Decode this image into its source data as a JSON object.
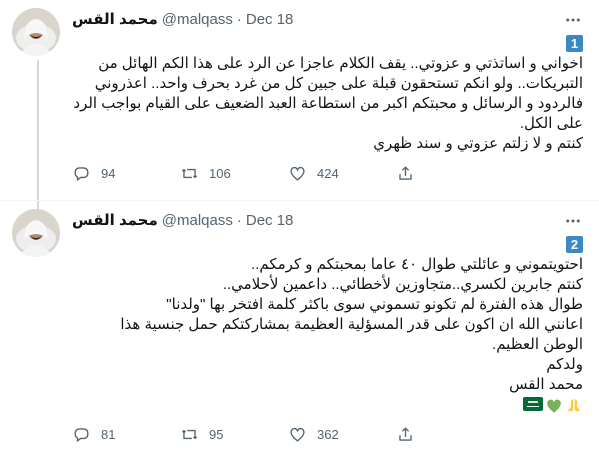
{
  "tweets": [
    {
      "name": "محمد القس",
      "handle": "@malqass",
      "dot": "·",
      "date": "Dec 18",
      "badge": "1",
      "lines": [
        "اخواني و اساتذتي و عزوتي.. يقف الكلام عاجزا عن الرد على هذا الكم الهائل من",
        "التبريكات.. ولو انكم تستحقون قبلة على جبين كل  من غرد بحرف واحد.. اعذروني",
        "فالردود و الرسائل و محبتكم اكبر من استطاعة العبد الضعيف على القيام بواجب الرد",
        "على الكل.",
        "كنتم و لا زلتم عزوتي و سند ظهري"
      ],
      "replies": "94",
      "retweets": "106",
      "likes": "424"
    },
    {
      "name": "محمد القس",
      "handle": "@malqass",
      "dot": "·",
      "date": "Dec 18",
      "badge": "2",
      "lines": [
        "احتويتموني و عائلتي طوال ٤٠ عاما بمحبتكم و كرمكم..",
        "كنتم جابرين لكسري..متجاوزين لأخطائي.. داعمين لأحلامي..",
        "طوال هذه الفترة لم تكونو تسموني سوى باكثر كلمة افتخر بها \"ولدنا\"",
        "اعانني الله ان اكون على قدر المسؤلية العظيمة بمشاركتكم حمل جنسية هذا",
        "الوطن العظيم.",
        "ولدكم",
        "محمد القس"
      ],
      "emojis": [
        "flag-icon",
        "green-heart-icon",
        "folded-hands-icon"
      ],
      "replies": "81",
      "retweets": "95",
      "likes": "362"
    }
  ],
  "colors": {
    "accent_badge": "#3b88c3",
    "muted": "#536471",
    "thread_line": "#cfd9de",
    "green_heart": "#78b159"
  }
}
